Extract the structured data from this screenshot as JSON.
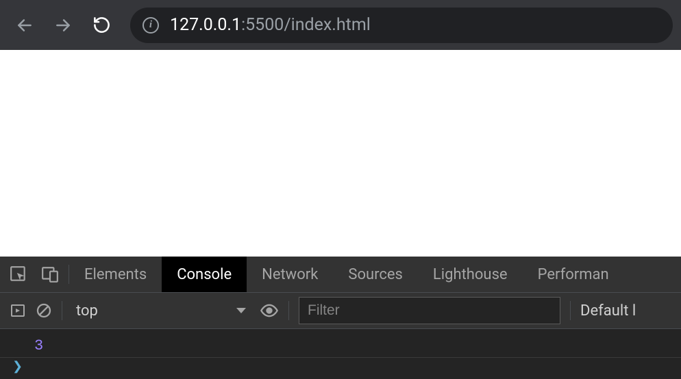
{
  "browser": {
    "url_host": "127.0.0.1",
    "url_path": ":5500/index.html"
  },
  "devtools": {
    "tabs": [
      {
        "label": "Elements"
      },
      {
        "label": "Console"
      },
      {
        "label": "Network"
      },
      {
        "label": "Sources"
      },
      {
        "label": "Lighthouse"
      },
      {
        "label": "Performan"
      }
    ],
    "active_tab_index": 1,
    "console": {
      "context_label": "top",
      "filter_placeholder": "Filter",
      "levels_label": "Default l",
      "output_value": "3"
    }
  }
}
